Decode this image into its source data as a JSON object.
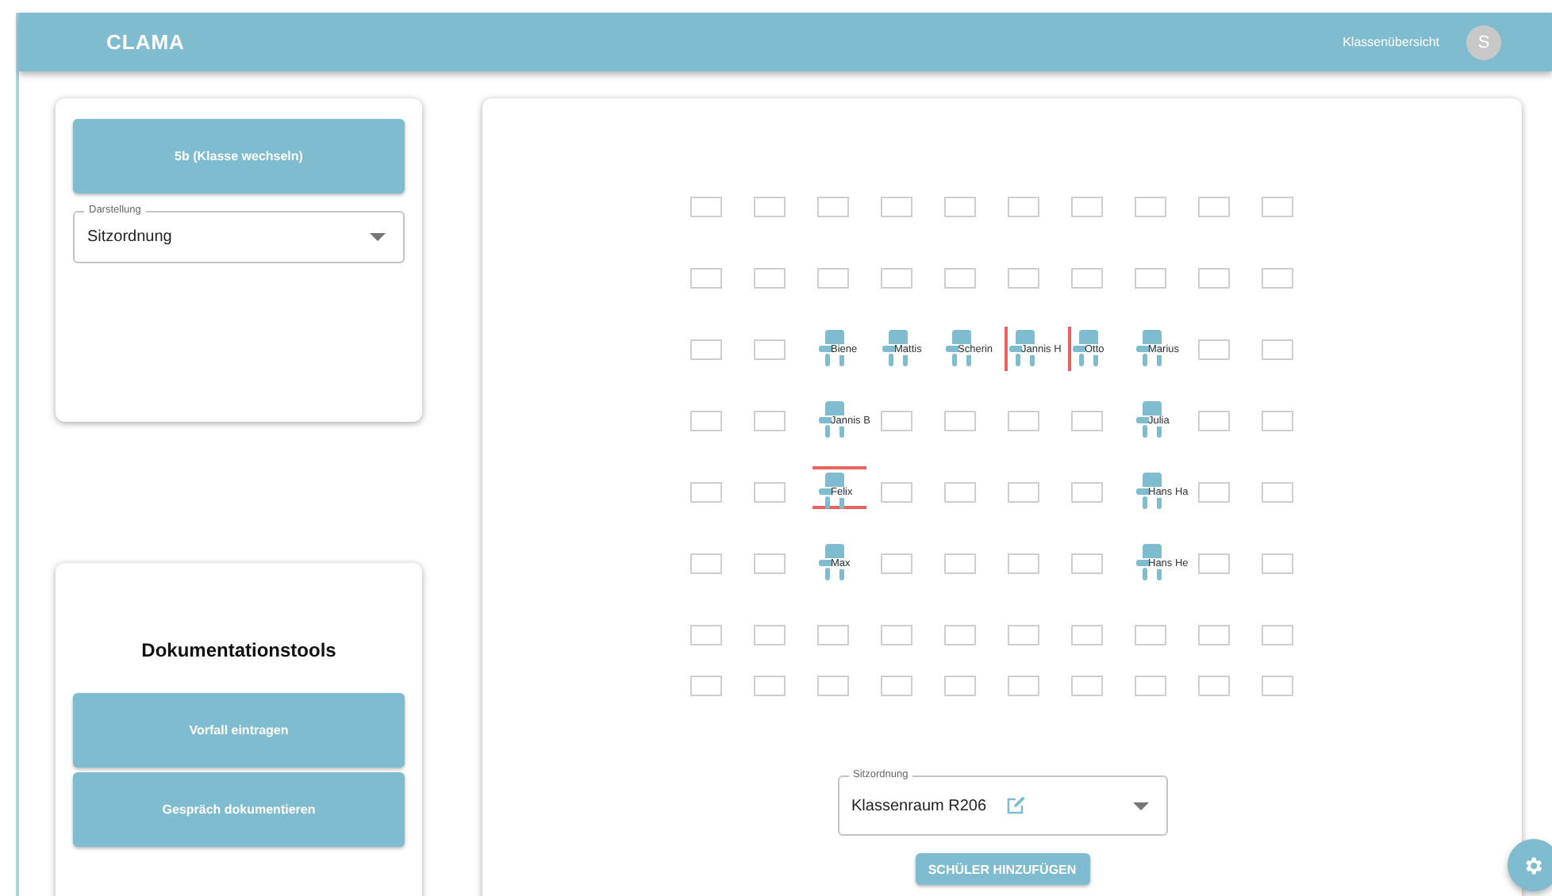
{
  "app_bar": {
    "title": "CLAMA",
    "nav_link": "Klassenübersicht",
    "avatar": "S"
  },
  "class_panel": {
    "class_button": "5b (Klasse wechseln)",
    "view_select": {
      "label": "Darstellung",
      "value": "Sitzordnung"
    }
  },
  "tools_panel": {
    "title": "Dokumentationstools",
    "buttons": [
      "Vorfall eintragen",
      "Gespräch dokumentieren"
    ]
  },
  "seating": {
    "rows": [
      [
        {
          "kind": "desk"
        },
        {
          "kind": "desk"
        },
        {
          "kind": "desk"
        },
        {
          "kind": "desk"
        },
        {
          "kind": "desk"
        },
        {
          "kind": "desk"
        },
        {
          "kind": "desk"
        },
        {
          "kind": "desk"
        },
        {
          "kind": "desk"
        },
        {
          "kind": "desk"
        }
      ],
      [
        {
          "kind": "desk"
        },
        {
          "kind": "desk"
        },
        {
          "kind": "desk"
        },
        {
          "kind": "desk"
        },
        {
          "kind": "desk"
        },
        {
          "kind": "desk"
        },
        {
          "kind": "desk"
        },
        {
          "kind": "desk"
        },
        {
          "kind": "desk"
        },
        {
          "kind": "desk"
        }
      ],
      [
        {
          "kind": "desk"
        },
        {
          "kind": "desk"
        },
        {
          "kind": "student",
          "name": "Biene",
          "marked_left": false,
          "marked_around": false
        },
        {
          "kind": "student",
          "name": "Mattis",
          "marked_left": false,
          "marked_around": false
        },
        {
          "kind": "student",
          "name": "Scherin",
          "marked_left": false,
          "marked_around": false
        },
        {
          "kind": "student",
          "name": "Jannis H",
          "marked_left": true,
          "marked_around": false
        },
        {
          "kind": "student",
          "name": "Otto",
          "marked_left": true,
          "marked_around": false
        },
        {
          "kind": "student",
          "name": "Marius",
          "marked_left": false,
          "marked_around": false
        },
        {
          "kind": "desk"
        },
        {
          "kind": "desk"
        }
      ],
      [
        {
          "kind": "desk"
        },
        {
          "kind": "desk"
        },
        {
          "kind": "student",
          "name": "Jannis B",
          "marked_left": false,
          "marked_around": false
        },
        {
          "kind": "desk"
        },
        {
          "kind": "desk"
        },
        {
          "kind": "desk"
        },
        {
          "kind": "desk"
        },
        {
          "kind": "student",
          "name": "Julia",
          "marked_left": false,
          "marked_around": false
        },
        {
          "kind": "desk"
        },
        {
          "kind": "desk"
        }
      ],
      [
        {
          "kind": "desk"
        },
        {
          "kind": "desk"
        },
        {
          "kind": "student",
          "name": "Felix",
          "marked_left": false,
          "marked_around": true
        },
        {
          "kind": "desk"
        },
        {
          "kind": "desk"
        },
        {
          "kind": "desk"
        },
        {
          "kind": "desk"
        },
        {
          "kind": "student",
          "name": "Hans Ha",
          "marked_left": false,
          "marked_around": false
        },
        {
          "kind": "desk"
        },
        {
          "kind": "desk"
        }
      ],
      [
        {
          "kind": "desk"
        },
        {
          "kind": "desk"
        },
        {
          "kind": "student",
          "name": "Max",
          "marked_left": false,
          "marked_around": false
        },
        {
          "kind": "desk"
        },
        {
          "kind": "desk"
        },
        {
          "kind": "desk"
        },
        {
          "kind": "desk"
        },
        {
          "kind": "student",
          "name": "Hans He",
          "marked_left": false,
          "marked_around": false
        },
        {
          "kind": "desk"
        },
        {
          "kind": "desk"
        }
      ],
      [
        {
          "kind": "desk"
        },
        {
          "kind": "desk"
        },
        {
          "kind": "desk"
        },
        {
          "kind": "desk"
        },
        {
          "kind": "desk"
        },
        {
          "kind": "desk"
        },
        {
          "kind": "desk"
        },
        {
          "kind": "desk"
        },
        {
          "kind": "desk"
        },
        {
          "kind": "desk"
        }
      ],
      [
        {
          "kind": "desk"
        },
        {
          "kind": "desk"
        },
        {
          "kind": "desk"
        },
        {
          "kind": "desk"
        },
        {
          "kind": "desk"
        },
        {
          "kind": "desk"
        },
        {
          "kind": "desk"
        },
        {
          "kind": "desk"
        },
        {
          "kind": "desk"
        },
        {
          "kind": "desk"
        }
      ]
    ],
    "layout_select": {
      "label": "Sitzordnung",
      "value": "Klassenraum R206"
    },
    "add_button": "SCHÜLER HINZUFÜGEN"
  }
}
